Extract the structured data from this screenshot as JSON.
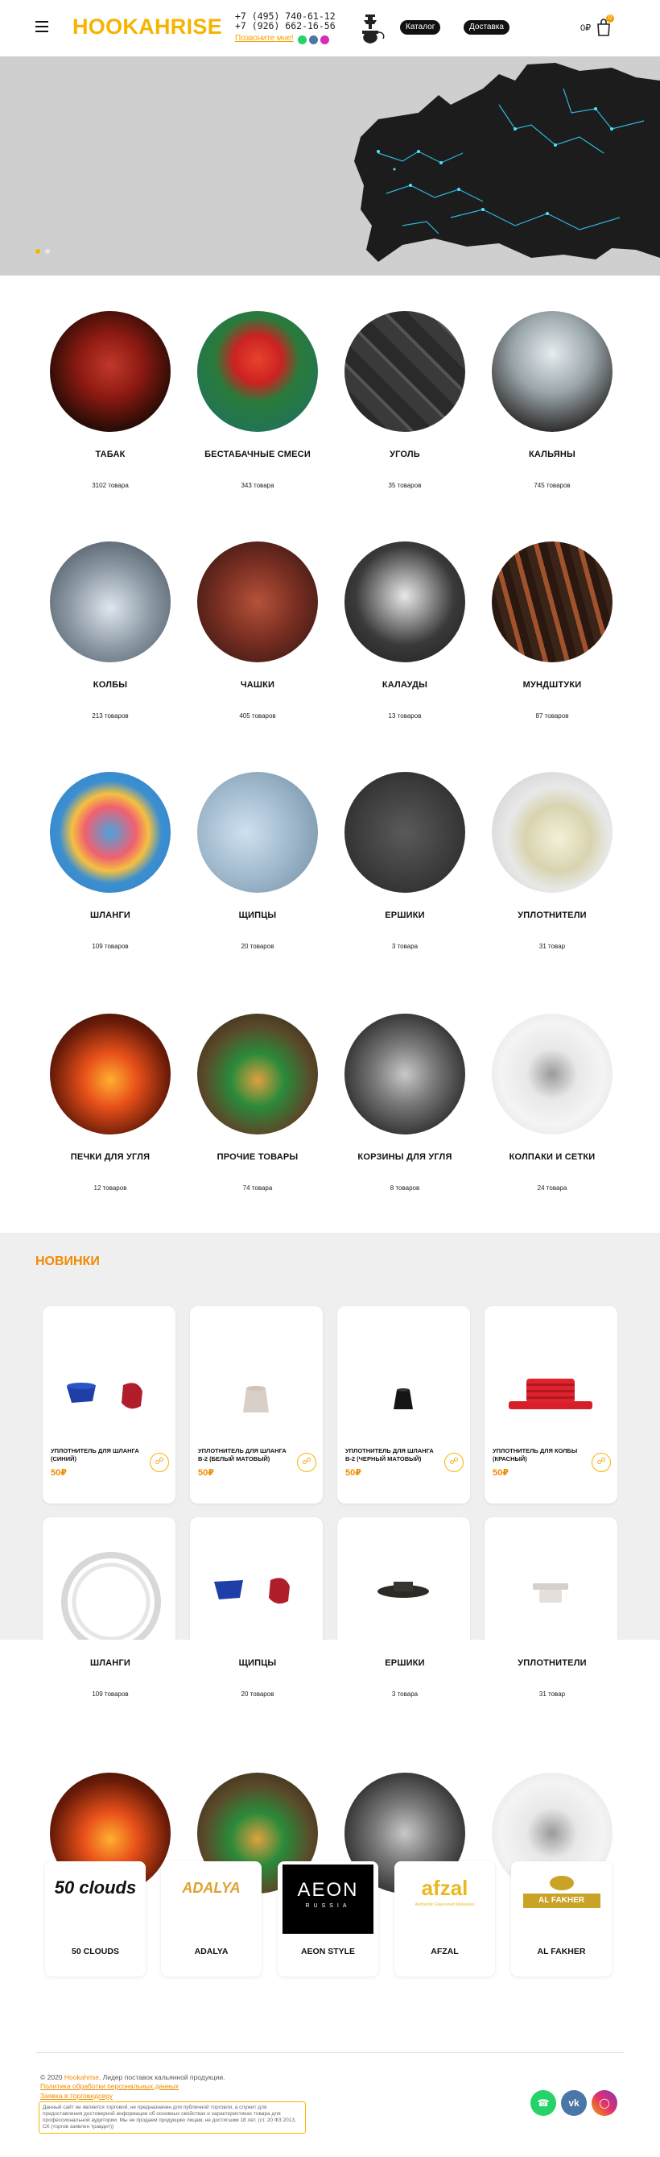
{
  "header": {
    "logo": "HOOKAHRISE",
    "phone1": "+7 (495) 740-61-12",
    "phone2": "+7 (926) 662-16-56",
    "callback_label": "Позвоните мне!",
    "catalog_label": "Каталог",
    "delivery_label": "Доставка",
    "cart_sum": "0₽",
    "cart_count": "0"
  },
  "categories": [
    {
      "name": "ТАБАК",
      "count": "3102 товара"
    },
    {
      "name": "БЕСТАБАЧНЫЕ СМЕСИ",
      "count": "343 товара"
    },
    {
      "name": "УГОЛЬ",
      "count": "35 товаров"
    },
    {
      "name": "КАЛЬЯНЫ",
      "count": "745 товаров"
    },
    {
      "name": "КОЛБЫ",
      "count": "213 товаров"
    },
    {
      "name": "ЧАШКИ",
      "count": "405 товаров"
    },
    {
      "name": "КАЛАУДЫ",
      "count": "13 товаров"
    },
    {
      "name": "МУНДШТУКИ",
      "count": "87 товаров"
    },
    {
      "name": "ШЛАНГИ",
      "count": "109 товаров"
    },
    {
      "name": "ЩИПЦЫ",
      "count": "20 товаров"
    },
    {
      "name": "ЕРШИКИ",
      "count": "3 товара"
    },
    {
      "name": "УПЛОТНИТЕЛИ",
      "count": "31 товар"
    },
    {
      "name": "ПЕЧКИ ДЛЯ УГЛЯ",
      "count": "12 товаров"
    },
    {
      "name": "ПРОЧИЕ ТОВАРЫ",
      "count": "74 товара"
    },
    {
      "name": "КОРЗИНЫ ДЛЯ УГЛЯ",
      "count": "8 товаров"
    },
    {
      "name": "КОЛПАКИ И СЕТКИ",
      "count": "24 товара"
    }
  ],
  "overlap_categories": [
    {
      "name": "ШЛАНГИ",
      "count": "109 товаров"
    },
    {
      "name": "ЩИПЦЫ",
      "count": "20 товаров"
    },
    {
      "name": "ЕРШИКИ",
      "count": "3 товара"
    },
    {
      "name": "УПЛОТНИТЕЛИ",
      "count": "31 товар"
    }
  ],
  "new_section": {
    "title": "НОВИНКИ",
    "products": [
      {
        "name": "УПЛОТНИТЕЛЬ ДЛЯ ШЛАНГА (СИНИЙ)",
        "price": "50₽"
      },
      {
        "name": "УПЛОТНИТЕЛЬ ДЛЯ ШЛАНГА В-2 (БЕЛЫЙ МАТОВЫЙ)",
        "price": "50₽"
      },
      {
        "name": "УПЛОТНИТЕЛЬ ДЛЯ ШЛАНГА В-2 (ЧЕРНЫЙ МАТОВЫЙ)",
        "price": "50₽"
      },
      {
        "name": "УПЛОТНИТЕЛЬ ДЛЯ КОЛБЫ (КРАСНЫЙ)",
        "price": "50₽"
      }
    ]
  },
  "brands": [
    {
      "name": "50 CLOUDS",
      "logo_text": "50 clouds"
    },
    {
      "name": "ADALYA",
      "logo_text": "ADALYA"
    },
    {
      "name": "AEON STYLE",
      "logo_text": "AEON",
      "logo_sub": "RUSSIA"
    },
    {
      "name": "AFZAL",
      "logo_text": "afzal",
      "logo_sub": "Authentic Flavoured Molasses"
    },
    {
      "name": "AL FAKHER",
      "logo_text": "AL FAKHER"
    }
  ],
  "footer": {
    "copyright_prefix": "© 2020",
    "copyright_brand": "Hookahrise",
    "copyright_text": ". Лидер поставок кальянной продукции.",
    "privacy_link": "Политика обработки персональных данных",
    "wholesale_link": "Заявка в торговидсеру",
    "note": "Данный сайт не является торговой, не предназначен для публичной торговли, а служит для предоставления достоверной информации об основных свойствах и характеристиках товара для профессиональной аудитории. Мы не продаем продукцию лицам, не достигшим 18 лет. (ст. 20 ФЗ 2013, СК (торгов заявлен травдит))"
  },
  "colors": {
    "accent": "#f5b400",
    "accent_text": "#f08a00",
    "whatsapp": "#25d366",
    "vk": "#4a76a8",
    "instagram": "#e1306c"
  }
}
